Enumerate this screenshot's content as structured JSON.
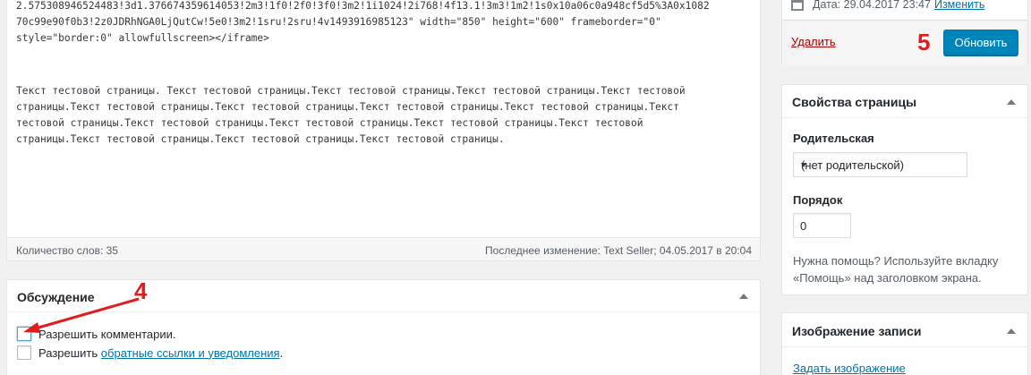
{
  "editor": {
    "code_text": "2.575308946524483!3d1.376674359614053!2m3!1f0!2f0!3f0!3m2!1i1024!2i768!4f13.1!3m3!1m2!1s0x10a06c0a948cf5d5%3A0x1082\n70c99e90f0b3!2z0JDRhNGA0LjQutCw!5e0!3m2!1sru!2sru!4v1493916985123\" width=\"850\" height=\"600\" frameborder=\"0\"\nstyle=\"border:0\" allowfullscreen></iframe>",
    "paragraph_text": "Текст тестовой страницы. Текст тестовой страницы.Текст тестовой страницы.Текст тестовой страницы.Текст тестовой\nстраницы.Текст тестовой страницы.Текст тестовой страницы.Текст тестовой страницы.Текст тестовой страницы.Текст\nтестовой страницы.Текст тестовой страницы.Текст тестовой страницы.Текст тестовой страницы.Текст тестовой\nстраницы.Текст тестовой страницы.Текст тестовой страницы.Текст тестовой страницы."
  },
  "statusbar": {
    "word_count": "Количество слов: 35",
    "last_modified": "Последнее изменение: Text Seller; 04.05.2017 в 20:04"
  },
  "discussion": {
    "title": "Обсуждение",
    "allow_comments": "Разрешить комментарии.",
    "allow_prefix": "Разрешить ",
    "trackbacks_link": "обратные ссылки и уведомления",
    "trackbacks_suffix": "."
  },
  "publish": {
    "date_label": "Дата: 29.04.2017 23:47",
    "edit_link": "Изменить",
    "delete_label": "Удалить",
    "update_label": "Обновить"
  },
  "page_attributes": {
    "title": "Свойства страницы",
    "parent_label": "Родительская",
    "parent_value": "(нет родительской)",
    "order_label": "Порядок",
    "order_value": "0",
    "help_text": "Нужна помощь? Используйте вкладку «Помощь» над заголовком экрана."
  },
  "featured_image": {
    "title": "Изображение записи",
    "set_link": "Задать изображение"
  },
  "annotations": {
    "step4": "4",
    "step5": "5"
  },
  "colors": {
    "accent": "#0085ba",
    "link": "#0073aa",
    "delete": "#aa0000",
    "annotation": "#e21b1b"
  }
}
